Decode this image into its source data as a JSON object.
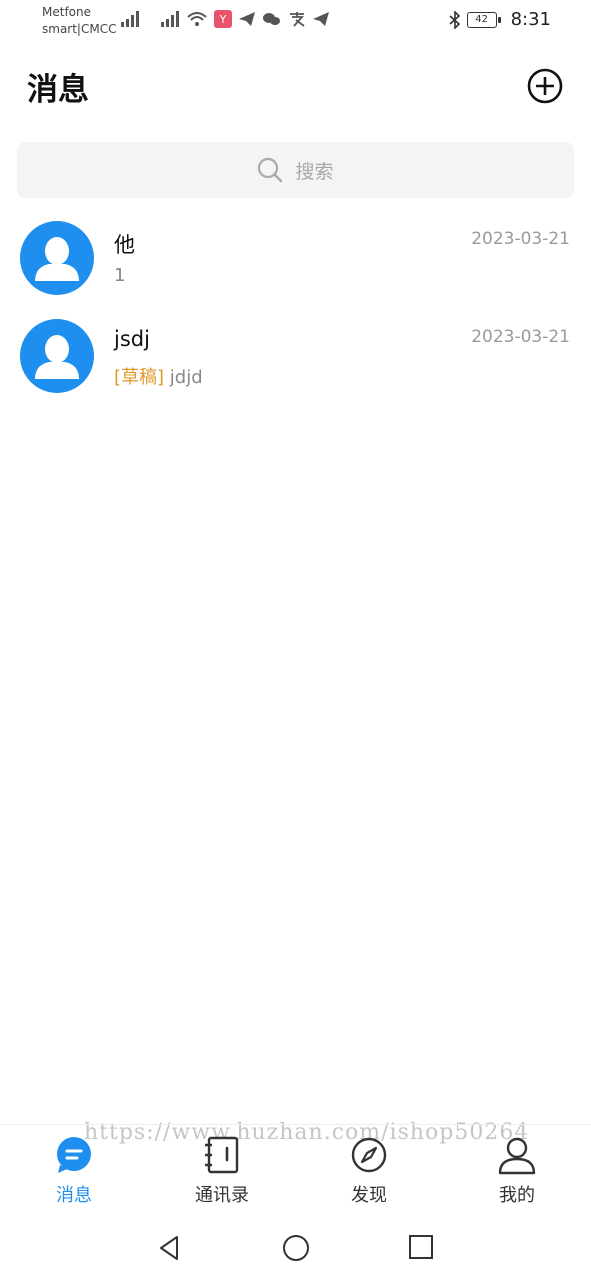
{
  "status_bar": {
    "carrier_line1": "Metfone",
    "carrier_line2": "smart|CMCC",
    "battery": "42",
    "time": "8:31"
  },
  "header": {
    "title": "消息"
  },
  "search": {
    "placeholder": "搜索"
  },
  "conversations": [
    {
      "name": "他",
      "time": "2023-03-21",
      "preview": "1",
      "draft_tag": ""
    },
    {
      "name": "jsdj",
      "time": "2023-03-21",
      "preview": "jdjd",
      "draft_tag": "[草稿]"
    }
  ],
  "tabbar": {
    "tabs": [
      {
        "label": "消息",
        "icon": "chat-bubble-icon",
        "active": true
      },
      {
        "label": "通讯录",
        "icon": "contacts-book-icon",
        "active": false
      },
      {
        "label": "发现",
        "icon": "compass-icon",
        "active": false
      },
      {
        "label": "我的",
        "icon": "person-icon",
        "active": false
      }
    ]
  },
  "watermark": "https://www.huzhan.com/ishop50264",
  "colors": {
    "accent": "#1e8fee",
    "draft": "#e0982c",
    "search_bg": "#f3f4f6",
    "muted_text": "#9a9a9a"
  }
}
